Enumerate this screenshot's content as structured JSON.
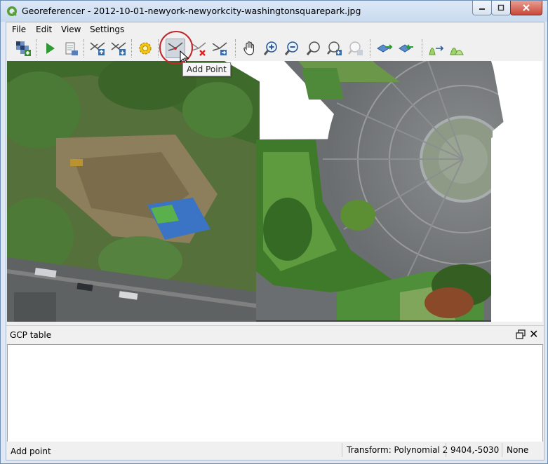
{
  "window": {
    "title": "Georeferencer - 2012-10-01-newyork-newyorkcity-washingtonsquarepark.jpg"
  },
  "menu": [
    "File",
    "Edit",
    "View",
    "Settings"
  ],
  "toolbar": {
    "tools": [
      {
        "name": "open-raster-icon"
      },
      {
        "name": "start-georeferencing-icon"
      },
      {
        "name": "generate-gdal-script-icon"
      },
      {
        "name": "load-gcp-points-icon"
      },
      {
        "name": "save-gcp-points-icon"
      },
      {
        "name": "transformation-settings-icon"
      },
      {
        "name": "add-point-icon"
      },
      {
        "name": "delete-point-icon"
      },
      {
        "name": "move-gcp-point-icon"
      },
      {
        "name": "pan-icon"
      },
      {
        "name": "zoom-in-icon"
      },
      {
        "name": "zoom-out-icon"
      },
      {
        "name": "zoom-to-layer-icon"
      },
      {
        "name": "zoom-last-icon"
      },
      {
        "name": "zoom-next-icon"
      },
      {
        "name": "link-georeferencer-to-qgis-icon"
      },
      {
        "name": "link-qgis-to-georeferencer-icon"
      },
      {
        "name": "full-histogram-stretch-icon"
      },
      {
        "name": "local-histogram-stretch-icon"
      }
    ],
    "tooltip": "Add Point",
    "active_tool": "add-point-icon"
  },
  "gcp_panel": {
    "title": "GCP table"
  },
  "status": {
    "message": "Add point",
    "transform": "Transform: Polynomial 2",
    "coordinates": "9404,-5030",
    "projection": "None"
  },
  "colors": {
    "title_bar": "#c9daef",
    "accent_red": "#c72a2a",
    "highlight_circle": "#c0262b"
  }
}
